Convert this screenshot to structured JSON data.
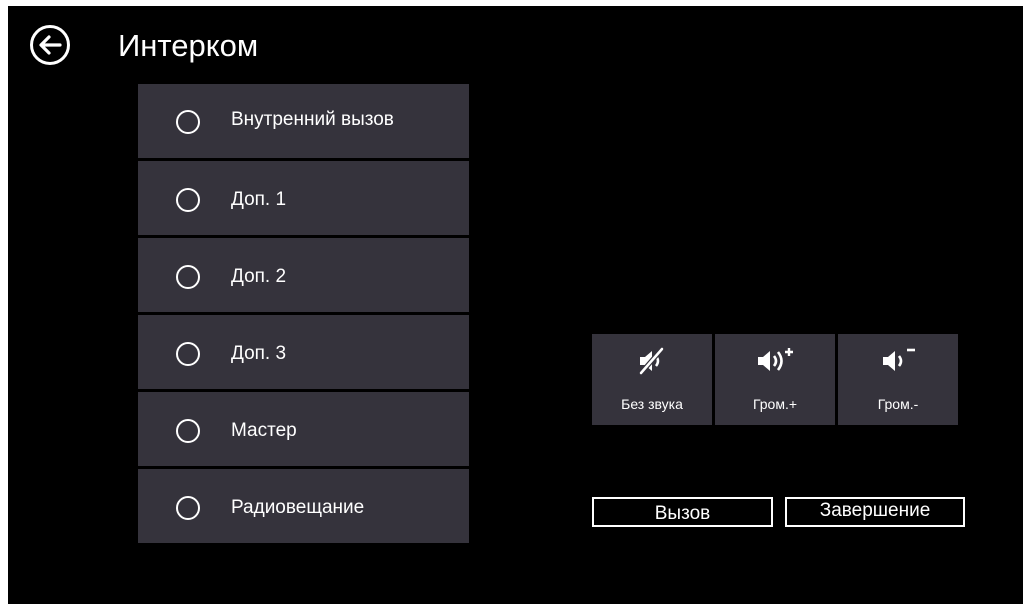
{
  "header": {
    "title": "Интерком"
  },
  "intercom_list": [
    {
      "label": "Внутренний вызов"
    },
    {
      "label": "Доп. 1"
    },
    {
      "label": "Доп. 2"
    },
    {
      "label": "Доп. 3"
    },
    {
      "label": "Мастер"
    },
    {
      "label": "Радиовещание"
    }
  ],
  "audio_controls": {
    "mute_label": "Без звука",
    "volume_up_label": "Гром.+",
    "volume_down_label": "Гром.-"
  },
  "actions": {
    "call_label": "Вызов",
    "end_label": "Завершение"
  },
  "colors": {
    "background": "#000000",
    "panel": "#35333c",
    "text": "#ffffff"
  }
}
